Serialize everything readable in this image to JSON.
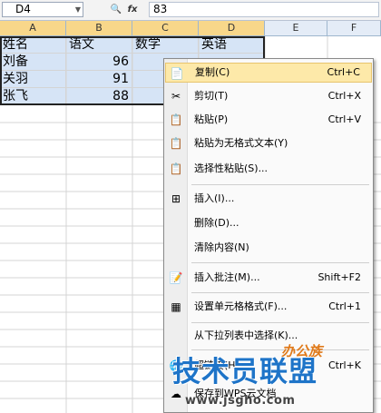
{
  "formula_bar": {
    "name_box": "D4",
    "value": "83",
    "fx_label": "fx"
  },
  "columns": [
    "A",
    "B",
    "C",
    "D",
    "E",
    "F"
  ],
  "rows": [
    [
      "姓名",
      "语文",
      "数学",
      "英语"
    ],
    [
      "刘备",
      "96",
      "",
      ""
    ],
    [
      "关羽",
      "91",
      "",
      ""
    ],
    [
      "张飞",
      "88",
      "",
      ""
    ]
  ],
  "context_menu": {
    "items": [
      {
        "label": "复制(C)",
        "shortcut": "Ctrl+C",
        "icon": "copy-icon"
      },
      {
        "label": "剪切(T)",
        "shortcut": "Ctrl+X",
        "icon": "scissors-icon"
      },
      {
        "label": "粘贴(P)",
        "shortcut": "Ctrl+V",
        "icon": "paste-icon"
      },
      {
        "label": "粘贴为无格式文本(Y)",
        "shortcut": "",
        "icon": "paste-text-icon"
      },
      {
        "label": "选择性粘贴(S)...",
        "shortcut": "",
        "icon": "paste-special-icon"
      },
      {
        "label": "插入(I)...",
        "shortcut": "",
        "icon": "insert-cells-icon"
      },
      {
        "label": "删除(D)...",
        "shortcut": "",
        "icon": ""
      },
      {
        "label": "清除内容(N)",
        "shortcut": "",
        "icon": ""
      },
      {
        "label": "插入批注(M)...",
        "shortcut": "Shift+F2",
        "icon": "comment-icon"
      },
      {
        "label": "设置单元格格式(F)...",
        "shortcut": "Ctrl+1",
        "icon": "format-cells-icon"
      },
      {
        "label": "从下拉列表中选择(K)...",
        "shortcut": "",
        "icon": ""
      },
      {
        "label": "超链接(H)...",
        "shortcut": "Ctrl+K",
        "icon": "hyperlink-icon"
      },
      {
        "label": "保存到WPS云文档",
        "shortcut": "",
        "icon": "cloud-icon"
      }
    ]
  },
  "watermark": {
    "main": "技术员联盟",
    "logo": "办公族",
    "url": "www.jsgho.com"
  },
  "colors": {
    "selection": "#d6e4f6",
    "highlight": "#fde9a9",
    "header": "#e4ecf7"
  }
}
